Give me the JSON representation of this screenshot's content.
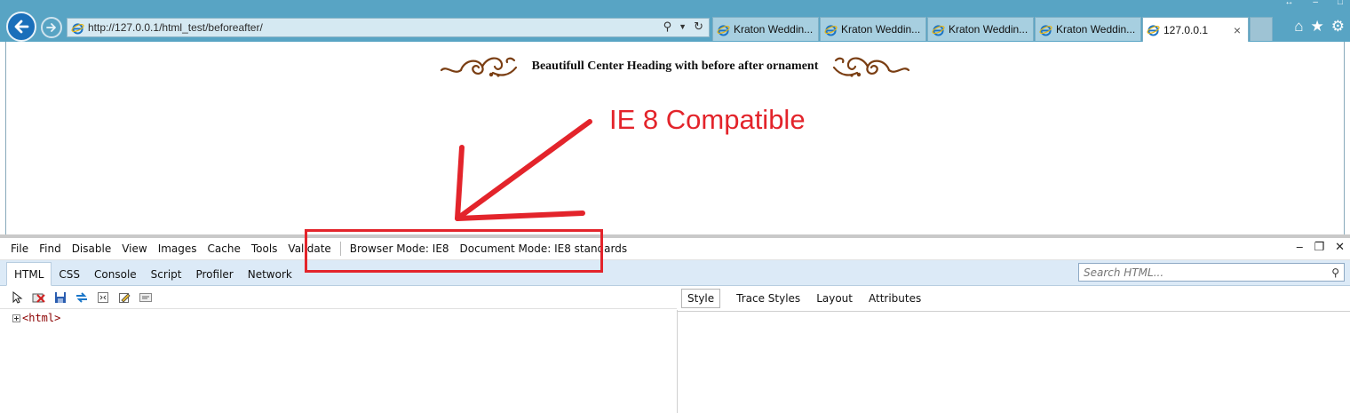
{
  "browser": {
    "address_url": "http://127.0.0.1/html_test/beforeafter/",
    "tabs": [
      {
        "label": "Kraton Weddin...",
        "active": false
      },
      {
        "label": "Kraton Weddin...",
        "active": false
      },
      {
        "label": "Kraton Weddin...",
        "active": false
      },
      {
        "label": "Kraton Weddin...",
        "active": false
      },
      {
        "label": "127.0.0.1",
        "active": true,
        "close": "×"
      }
    ]
  },
  "page": {
    "heading": "Beautifull Center Heading with before after ornament",
    "annotation": "IE 8 Compatible",
    "ornament_color": "#7a3e13",
    "annotation_color": "#e3242b"
  },
  "devtools": {
    "menu": [
      "File",
      "Find",
      "Disable",
      "View",
      "Images",
      "Cache",
      "Tools",
      "Validate"
    ],
    "browser_mode": "Browser Mode: IE8",
    "document_mode": "Document Mode:  IE8 standards",
    "tabs": [
      "HTML",
      "CSS",
      "Console",
      "Script",
      "Profiler",
      "Network"
    ],
    "search_placeholder": "Search HTML...",
    "tree_root": "<html>",
    "right_tabs": [
      "Style",
      "Trace Styles",
      "Layout",
      "Attributes"
    ]
  }
}
